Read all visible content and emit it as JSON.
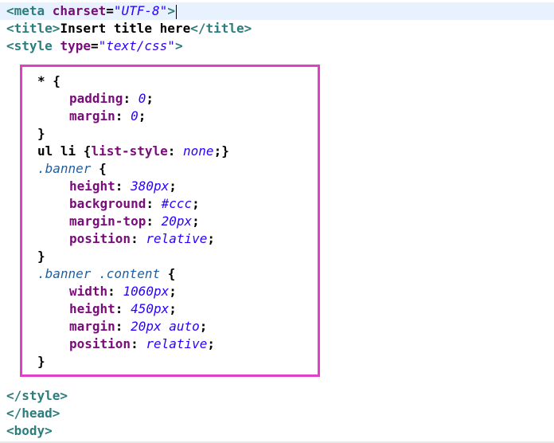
{
  "html_head": {
    "meta": {
      "open": "<meta ",
      "attr": "charset",
      "eq": "=",
      "value": "\"UTF-8\"",
      "close": ">"
    },
    "title": {
      "open": "<title>",
      "text": "Insert title here",
      "close": "</title>"
    },
    "style": {
      "open": "<style ",
      "attr": "type",
      "eq": "=",
      "value": "\"text/css\"",
      "close": ">"
    }
  },
  "css": {
    "universal": {
      "selector": "* {",
      "props": [
        {
          "name": "padding",
          "value": "0"
        },
        {
          "name": "margin",
          "value": "0"
        }
      ],
      "end": "}"
    },
    "ul_li": {
      "selector": "ul li {",
      "prop": "list-style",
      "value": "none",
      "end": ";}"
    },
    "banner": {
      "selector": ".banner",
      "open": " {",
      "props": [
        {
          "name": "height",
          "value": "380px"
        },
        {
          "name": "background",
          "value": "#ccc"
        },
        {
          "name": "margin-top",
          "value": "20px"
        },
        {
          "name": "position",
          "value": "relative"
        }
      ],
      "end": "}"
    },
    "banner_content": {
      "selector": ".banner .content",
      "open": " {",
      "props": [
        {
          "name": "width",
          "value": "1060px"
        },
        {
          "name": "height",
          "value": "450px"
        },
        {
          "name": "margin",
          "value": "20px auto"
        },
        {
          "name": "position",
          "value": "relative"
        }
      ],
      "end": "}"
    }
  },
  "closing": {
    "style_close": "</style>",
    "head_close": "</head>",
    "body_open": "<body>"
  },
  "colors": {
    "highlight_border": "#e040c8",
    "tag": "#2e7d7d",
    "property": "#7a0b7a",
    "value": "#2a00ff",
    "current_line": "#e8f2fe"
  }
}
